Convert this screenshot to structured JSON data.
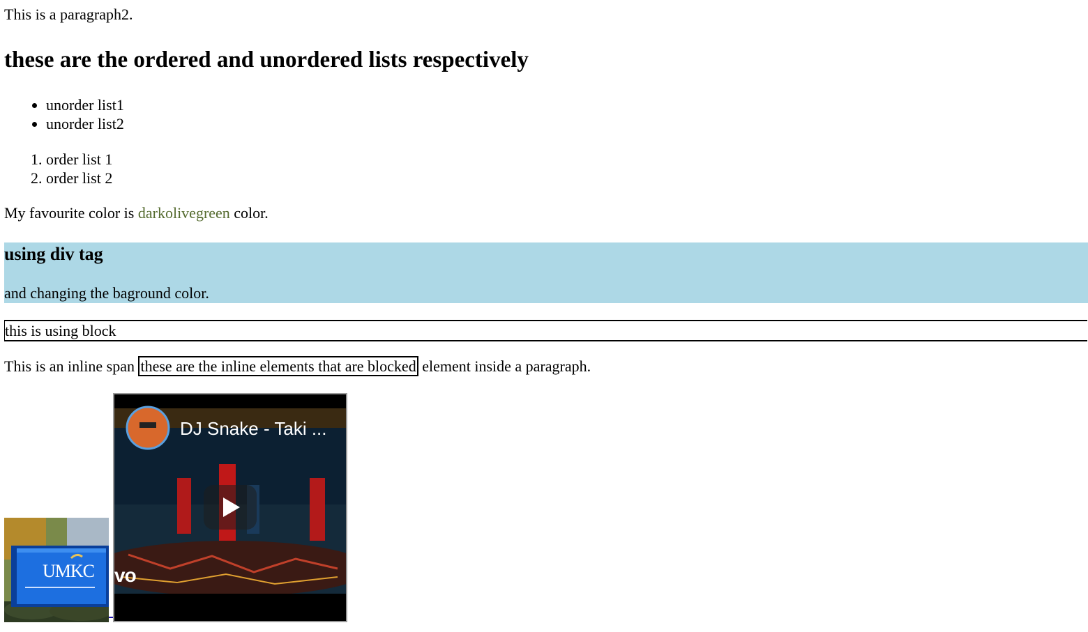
{
  "paragraph2": "This is a paragraph2.",
  "lists_heading": "these are the ordered and unordered lists respectively",
  "unordered_list": [
    "unorder list1",
    "unorder list2"
  ],
  "ordered_list": [
    "order list 1",
    "order list 2"
  ],
  "favourite": {
    "prefix": "My favourite color is ",
    "color_word": "darkolivegreen",
    "suffix": " color."
  },
  "div_section": {
    "heading": "using div tag",
    "text": "and changing the baground color.",
    "background": "#add8e6"
  },
  "block_text": "this is using block",
  "inline_paragraph": {
    "prefix": "This is an inline span ",
    "span_text": "these are the inline elements that are blocked",
    "suffix": " element inside a paragraph."
  },
  "images": {
    "umkc_sign_text": "UMKC"
  },
  "video": {
    "title": "DJ Snake - Taki ...",
    "watermark": "vo",
    "play_icon": "play-icon"
  }
}
